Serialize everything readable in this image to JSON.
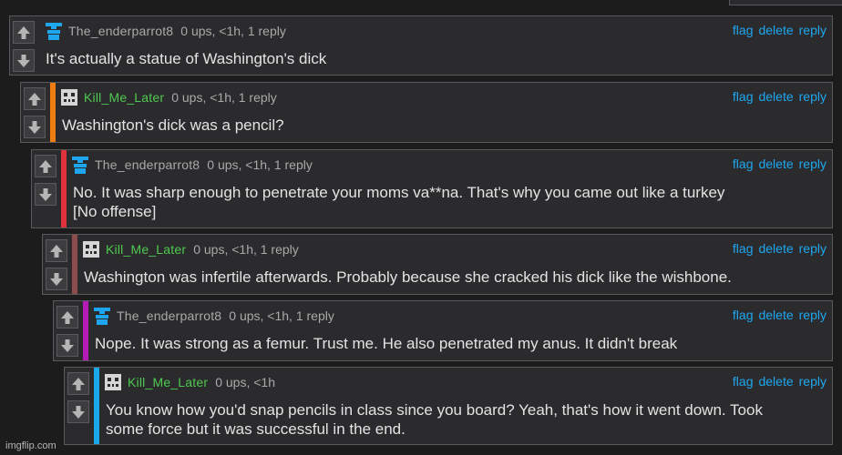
{
  "actions": {
    "flag": "flag",
    "delete": "delete",
    "reply": "reply"
  },
  "colors": {
    "enderparrot_avatar": "#1ea7f0",
    "kill_avatar": "#d6d6d6",
    "kill_name": "#4fc94f",
    "link": "#1ea7f0",
    "bar_orange": "#ef7d12",
    "bar_red": "#e0323b",
    "bar_brown": "#8e4d4d",
    "bar_magenta": "#b71bb7",
    "bar_cyan": "#19a8ea"
  },
  "comments": [
    {
      "user": "The_enderparrot8",
      "meta": "0 ups, <1h, 1 reply",
      "avatar": "enderparrot-avatar-icon",
      "text": "It's actually a statue of Washington's dick"
    },
    {
      "user": "Kill_Me_Later",
      "meta": "0 ups, <1h, 1 reply",
      "avatar": "robot-avatar-icon",
      "text": "Washington's dick was a pencil?"
    },
    {
      "user": "The_enderparrot8",
      "meta": "0 ups, <1h, 1 reply",
      "avatar": "enderparrot-avatar-icon",
      "text": "No. It was sharp enough to penetrate your moms va**na. That's why you came out like a turkey\n[No offense]"
    },
    {
      "user": "Kill_Me_Later",
      "meta": "0 ups, <1h, 1 reply",
      "avatar": "robot-avatar-icon",
      "text": "Washington was infertile afterwards. Probably because she cracked his dick like the wishbone."
    },
    {
      "user": "The_enderparrot8",
      "meta": "0 ups, <1h, 1 reply",
      "avatar": "enderparrot-avatar-icon",
      "text": "Nope. It was strong as a femur. Trust me. He also penetrated my anus. It didn't break"
    },
    {
      "user": "Kill_Me_Later",
      "meta": "0 ups, <1h",
      "avatar": "robot-avatar-icon",
      "text": "You know how you'd snap pencils in class since you board? Yeah, that's how it went down. Took\nsome force but it was successful in the end."
    }
  ],
  "watermark": "imgflip.com"
}
